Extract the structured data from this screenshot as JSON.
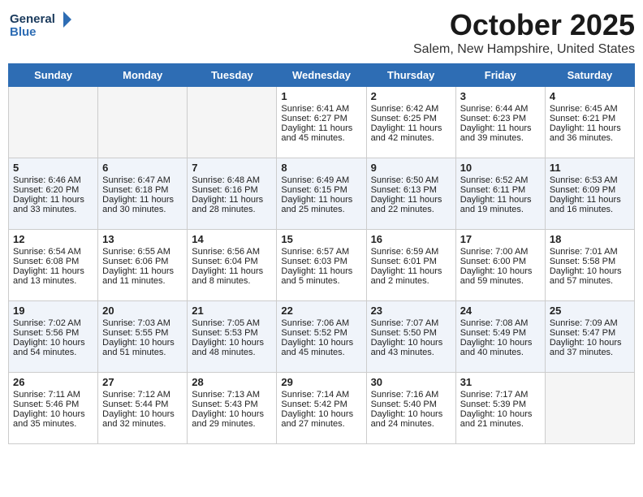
{
  "logo": {
    "line1": "General",
    "line2": "Blue"
  },
  "title": "October 2025",
  "location": "Salem, New Hampshire, United States",
  "days_of_week": [
    "Sunday",
    "Monday",
    "Tuesday",
    "Wednesday",
    "Thursday",
    "Friday",
    "Saturday"
  ],
  "weeks": [
    [
      {
        "day": "",
        "empty": true
      },
      {
        "day": "",
        "empty": true
      },
      {
        "day": "",
        "empty": true
      },
      {
        "day": "1",
        "sunrise": "Sunrise: 6:41 AM",
        "sunset": "Sunset: 6:27 PM",
        "daylight": "Daylight: 11 hours and 45 minutes."
      },
      {
        "day": "2",
        "sunrise": "Sunrise: 6:42 AM",
        "sunset": "Sunset: 6:25 PM",
        "daylight": "Daylight: 11 hours and 42 minutes."
      },
      {
        "day": "3",
        "sunrise": "Sunrise: 6:44 AM",
        "sunset": "Sunset: 6:23 PM",
        "daylight": "Daylight: 11 hours and 39 minutes."
      },
      {
        "day": "4",
        "sunrise": "Sunrise: 6:45 AM",
        "sunset": "Sunset: 6:21 PM",
        "daylight": "Daylight: 11 hours and 36 minutes."
      }
    ],
    [
      {
        "day": "5",
        "sunrise": "Sunrise: 6:46 AM",
        "sunset": "Sunset: 6:20 PM",
        "daylight": "Daylight: 11 hours and 33 minutes."
      },
      {
        "day": "6",
        "sunrise": "Sunrise: 6:47 AM",
        "sunset": "Sunset: 6:18 PM",
        "daylight": "Daylight: 11 hours and 30 minutes."
      },
      {
        "day": "7",
        "sunrise": "Sunrise: 6:48 AM",
        "sunset": "Sunset: 6:16 PM",
        "daylight": "Daylight: 11 hours and 28 minutes."
      },
      {
        "day": "8",
        "sunrise": "Sunrise: 6:49 AM",
        "sunset": "Sunset: 6:15 PM",
        "daylight": "Daylight: 11 hours and 25 minutes."
      },
      {
        "day": "9",
        "sunrise": "Sunrise: 6:50 AM",
        "sunset": "Sunset: 6:13 PM",
        "daylight": "Daylight: 11 hours and 22 minutes."
      },
      {
        "day": "10",
        "sunrise": "Sunrise: 6:52 AM",
        "sunset": "Sunset: 6:11 PM",
        "daylight": "Daylight: 11 hours and 19 minutes."
      },
      {
        "day": "11",
        "sunrise": "Sunrise: 6:53 AM",
        "sunset": "Sunset: 6:09 PM",
        "daylight": "Daylight: 11 hours and 16 minutes."
      }
    ],
    [
      {
        "day": "12",
        "sunrise": "Sunrise: 6:54 AM",
        "sunset": "Sunset: 6:08 PM",
        "daylight": "Daylight: 11 hours and 13 minutes."
      },
      {
        "day": "13",
        "sunrise": "Sunrise: 6:55 AM",
        "sunset": "Sunset: 6:06 PM",
        "daylight": "Daylight: 11 hours and 11 minutes."
      },
      {
        "day": "14",
        "sunrise": "Sunrise: 6:56 AM",
        "sunset": "Sunset: 6:04 PM",
        "daylight": "Daylight: 11 hours and 8 minutes."
      },
      {
        "day": "15",
        "sunrise": "Sunrise: 6:57 AM",
        "sunset": "Sunset: 6:03 PM",
        "daylight": "Daylight: 11 hours and 5 minutes."
      },
      {
        "day": "16",
        "sunrise": "Sunrise: 6:59 AM",
        "sunset": "Sunset: 6:01 PM",
        "daylight": "Daylight: 11 hours and 2 minutes."
      },
      {
        "day": "17",
        "sunrise": "Sunrise: 7:00 AM",
        "sunset": "Sunset: 6:00 PM",
        "daylight": "Daylight: 10 hours and 59 minutes."
      },
      {
        "day": "18",
        "sunrise": "Sunrise: 7:01 AM",
        "sunset": "Sunset: 5:58 PM",
        "daylight": "Daylight: 10 hours and 57 minutes."
      }
    ],
    [
      {
        "day": "19",
        "sunrise": "Sunrise: 7:02 AM",
        "sunset": "Sunset: 5:56 PM",
        "daylight": "Daylight: 10 hours and 54 minutes."
      },
      {
        "day": "20",
        "sunrise": "Sunrise: 7:03 AM",
        "sunset": "Sunset: 5:55 PM",
        "daylight": "Daylight: 10 hours and 51 minutes."
      },
      {
        "day": "21",
        "sunrise": "Sunrise: 7:05 AM",
        "sunset": "Sunset: 5:53 PM",
        "daylight": "Daylight: 10 hours and 48 minutes."
      },
      {
        "day": "22",
        "sunrise": "Sunrise: 7:06 AM",
        "sunset": "Sunset: 5:52 PM",
        "daylight": "Daylight: 10 hours and 45 minutes."
      },
      {
        "day": "23",
        "sunrise": "Sunrise: 7:07 AM",
        "sunset": "Sunset: 5:50 PM",
        "daylight": "Daylight: 10 hours and 43 minutes."
      },
      {
        "day": "24",
        "sunrise": "Sunrise: 7:08 AM",
        "sunset": "Sunset: 5:49 PM",
        "daylight": "Daylight: 10 hours and 40 minutes."
      },
      {
        "day": "25",
        "sunrise": "Sunrise: 7:09 AM",
        "sunset": "Sunset: 5:47 PM",
        "daylight": "Daylight: 10 hours and 37 minutes."
      }
    ],
    [
      {
        "day": "26",
        "sunrise": "Sunrise: 7:11 AM",
        "sunset": "Sunset: 5:46 PM",
        "daylight": "Daylight: 10 hours and 35 minutes."
      },
      {
        "day": "27",
        "sunrise": "Sunrise: 7:12 AM",
        "sunset": "Sunset: 5:44 PM",
        "daylight": "Daylight: 10 hours and 32 minutes."
      },
      {
        "day": "28",
        "sunrise": "Sunrise: 7:13 AM",
        "sunset": "Sunset: 5:43 PM",
        "daylight": "Daylight: 10 hours and 29 minutes."
      },
      {
        "day": "29",
        "sunrise": "Sunrise: 7:14 AM",
        "sunset": "Sunset: 5:42 PM",
        "daylight": "Daylight: 10 hours and 27 minutes."
      },
      {
        "day": "30",
        "sunrise": "Sunrise: 7:16 AM",
        "sunset": "Sunset: 5:40 PM",
        "daylight": "Daylight: 10 hours and 24 minutes."
      },
      {
        "day": "31",
        "sunrise": "Sunrise: 7:17 AM",
        "sunset": "Sunset: 5:39 PM",
        "daylight": "Daylight: 10 hours and 21 minutes."
      },
      {
        "day": "",
        "empty": true
      }
    ]
  ]
}
